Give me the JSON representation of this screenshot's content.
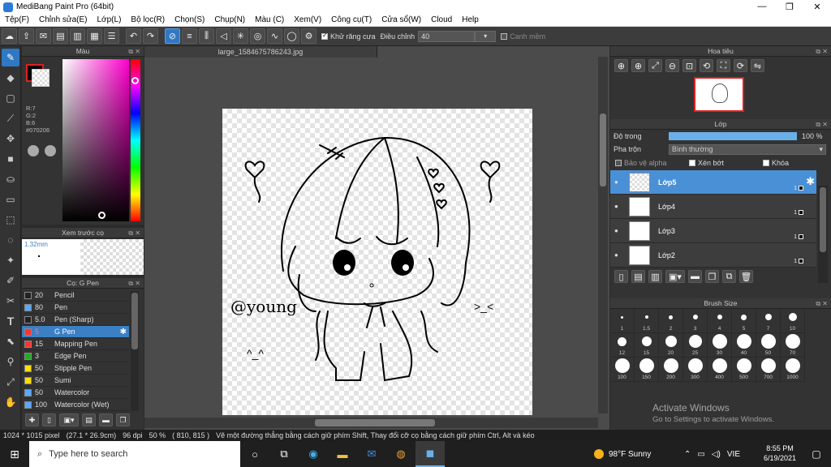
{
  "window": {
    "title": "MediBang Paint Pro (64bit)",
    "minimize": "—",
    "maximize": "❐",
    "close": "✕"
  },
  "menu": [
    "Tệp(F)",
    "Chỉnh sửa(E)",
    "Lớp(L)",
    "Bộ lọc(R)",
    "Chọn(S)",
    "Chụp(N)",
    "Màu (C)",
    "Xem(V)",
    "Công cụ(T)",
    "Cửa sổ(W)",
    "Cloud",
    "Help"
  ],
  "toolbar": {
    "antialias_label": "Khử răng cưa",
    "adjust_label": "Điều chỉnh",
    "adjust_value": "40",
    "snap_label": "Canh mềm"
  },
  "color_panel": {
    "title": "Màu",
    "r": "R:7",
    "g": "G:2",
    "b": "B:6",
    "hex": "#070206",
    "primary": "#070206",
    "accent": "#2f78c4"
  },
  "preview_panel": {
    "title": "Xem trước cọ",
    "size": "1.32mm"
  },
  "brush_panel": {
    "title": "Cọ: G Pen",
    "brushes": [
      {
        "size": "20",
        "name": "Pencil",
        "color": "#222222"
      },
      {
        "size": "80",
        "name": "Pen",
        "color": "#55aaff"
      },
      {
        "size": "5.0",
        "name": "Pen (Sharp)",
        "color": "#222222"
      },
      {
        "size": "5",
        "name": "G Pen",
        "color": "#ff3333"
      },
      {
        "size": "15",
        "name": "Mapping Pen",
        "color": "#ff3333"
      },
      {
        "size": "3",
        "name": "Edge Pen",
        "color": "#22aa22"
      },
      {
        "size": "50",
        "name": "Stipple Pen",
        "color": "#ffdd00"
      },
      {
        "size": "50",
        "name": "Sumi",
        "color": "#ffdd00"
      },
      {
        "size": "50",
        "name": "Watercolor",
        "color": "#55aaff"
      },
      {
        "size": "100",
        "name": "Watercolor (Wet)",
        "color": "#55aaff"
      }
    ]
  },
  "document": {
    "tab": "large_1584675786243.jpg",
    "handle": "@young",
    "face_left": "^_^",
    "face_right": ">_<"
  },
  "navigator": {
    "title": "Hoa tiêu"
  },
  "layer_panel": {
    "title": "Lớp",
    "opacity_label": "Độ trong",
    "opacity_value": "100 %",
    "opacity": 1.0,
    "blend_label": "Pha trộn",
    "blend_value": "Bình thường",
    "protect_alpha": "Bảo vệ alpha",
    "clipping": "Xén bớt",
    "lock": "Khóa",
    "layers": [
      {
        "name": "Lớp5",
        "num": "1"
      },
      {
        "name": "Lớp4",
        "num": "1"
      },
      {
        "name": "Lớp3",
        "num": "1"
      },
      {
        "name": "Lớp2",
        "num": "1"
      }
    ]
  },
  "brush_size_panel": {
    "title": "Brush Size",
    "sizes": [
      "1",
      "1.5",
      "2",
      "3",
      "4",
      "5",
      "7",
      "10",
      "12",
      "15",
      "20",
      "25",
      "30",
      "40",
      "50",
      "70",
      "100",
      "150",
      "200",
      "300",
      "400",
      "500",
      "700",
      "1000"
    ]
  },
  "status": {
    "dimensions": "1024 * 1015 pixel",
    "physical": "(27.1 * 26.9cm)",
    "dpi": "96 dpi",
    "zoom": "50 %",
    "coords": "( 810, 815 )",
    "hint": "Vẽ một đường thẳng bằng cách giữ phím Shift, Thay đổi cỡ cọ bằng cách giữ phím Ctrl, Alt và kéo"
  },
  "watermark": {
    "line1": "Activate Windows",
    "line2": "Go to Settings to activate Windows."
  },
  "taskbar": {
    "search_placeholder": "Type here to search",
    "weather": "98°F  Sunny",
    "lang": "VIE",
    "time": "8:55 PM",
    "date": "6/19/2021"
  }
}
